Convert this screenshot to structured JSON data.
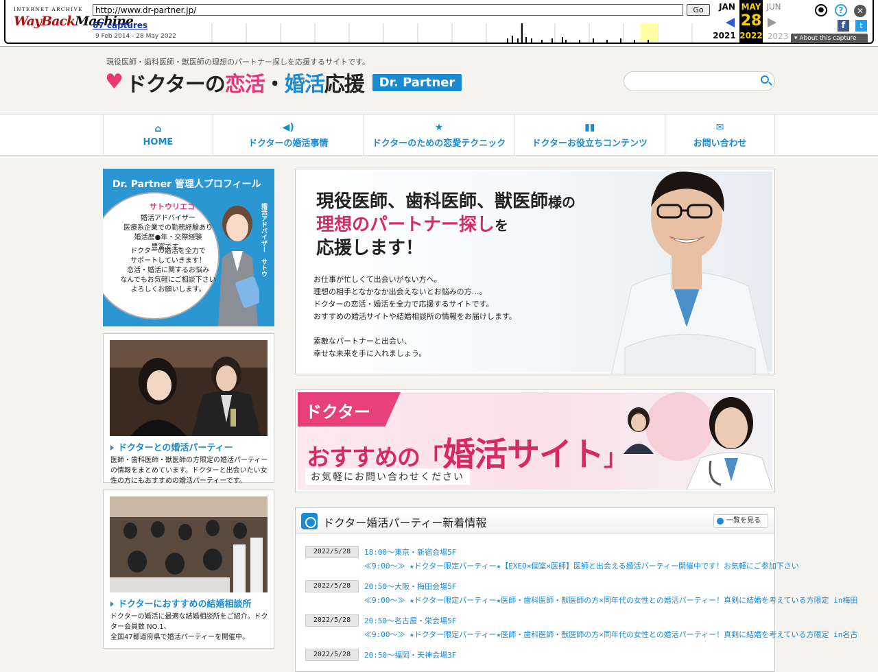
{
  "wayback": {
    "logo_top": "INTERNET ARCHIVE",
    "logo_main": "WayBack",
    "logo_main2": "Machine",
    "url": "http://www.dr-partner.jp/",
    "go_label": "Go",
    "captures": "67 captures",
    "range": "9 Feb 2014 - 28 May 2022",
    "month_prev": "JAN",
    "month_cur": "MAY",
    "month_next": "JUN",
    "day": "28",
    "year_prev": "2021",
    "year_cur": "2022",
    "year_next": "2023",
    "about": "About this capture",
    "fb": "f",
    "tw": "t",
    "help": "?",
    "close": "✕",
    "user": "●"
  },
  "header": {
    "tagline": "現役医師・歯科医師・獣医師の理想のパートナー探しを応援するサイトです。",
    "logo_pre": "ドクターの",
    "logo_koi": "恋活",
    "logo_dot": "・",
    "logo_kon": "婚活",
    "logo_post": "応援",
    "badge": "Dr. Partner",
    "search_placeholder": ""
  },
  "nav": {
    "items": [
      {
        "label": "HOME",
        "icon": "home-icon",
        "glyph": "⌂"
      },
      {
        "label": "ドクターの婚活事情",
        "icon": "megaphone-icon",
        "glyph": "◀)"
      },
      {
        "label": "ドクターのための恋愛テクニック",
        "icon": "star-icon",
        "glyph": "★"
      },
      {
        "label": "ドクターお役立ちコンテンツ",
        "icon": "book-icon",
        "glyph": "▮▮"
      },
      {
        "label": "お問い合わせ",
        "icon": "mail-icon",
        "glyph": "✉"
      }
    ]
  },
  "profile": {
    "title": "Dr. Partner  管理人プロフィール",
    "name": "サトウリエコ",
    "lines1": [
      "婚活アドバイザー",
      "医療系企業での勤務経験あり",
      "婚活歴●年・交際経験",
      "豊富です。"
    ],
    "lines2": [
      "ドクターの婚活を全力で",
      "サポートしていきます！",
      "恋活・婚活に関するお悩み",
      "なんでもお気軽にご相談下さい",
      "よろしくお願いします。"
    ],
    "vertical": "婚活アドバイザー　サトウ"
  },
  "cards": [
    {
      "title": "ドクターとの婚活パーティー",
      "text": "医師・歯科医師・獣医師の方限定の婚活パーティーの情報をまとめています。ドクターと出会いたい女性の方にもおすすめの婚活パーティーです。"
    },
    {
      "title": "ドクターにおすすめの結婚相談所",
      "text": "ドクターの婚活に最適な結婚相談所をご紹介。ドクター会員数 NO.1、",
      "text2": "全国47都道府県で婚活パーティーを開催中。"
    }
  ],
  "hero": {
    "line1a": "現役医師、歯科医師、獣医師",
    "line1b": "様の",
    "line2a": "理想のパートナー探し",
    "line2b": "を",
    "line3": "応援します！",
    "p1": [
      "お仕事が忙しくて出会いがない方へ。",
      "理想の相手となかなか出会えないとお悩みの方…。",
      "ドクターの恋活・婚活を全力で応援するサイトです。",
      "おすすめの婚活サイトや結婚相談所の情報をお届けします。"
    ],
    "p2": [
      "素敵なパートナーと出会い、",
      "幸せな未来を手に入れましょう。"
    ]
  },
  "banner": {
    "tag": "ドクター",
    "main_pre": "おすすめの「",
    "main_big": "婚活サイト",
    "main_post": "」",
    "sub": "お気軽にお問い合わせください"
  },
  "news": {
    "title": "ドクター婚活パーティー新着情報",
    "more": "一覧を見る",
    "rows": [
      {
        "date": "2022/5/28",
        "l1": "18:00～東京・新宿会場5F",
        "l2": "≪9:00～≫ ★ドクター限定パーティー★【EXEO×個室×医師】医師と出会える婚活パーティー開催中です！お気軽にご参加下さい"
      },
      {
        "date": "2022/5/28",
        "l1": "20:50～大阪・梅田会場5F",
        "l2": "≪9:00～≫ ★ドクター限定パーティー★医師・歯科医師・獣医師の方×同年代の女性との婚活パーティー！真剣に結婚を考えている方限定 in梅田"
      },
      {
        "date": "2022/5/28",
        "l1": "20:50～名古屋・栄会場5F",
        "l2": "≪9:00～≫ ★ドクター限定パーティー★医師・歯科医師・獣医師の方×同年代の女性との婚活パーティー！真剣に結婚を考えている方限定 in名古"
      },
      {
        "date": "2022/5/28",
        "l1": "20:50～福岡・天神会場3F",
        "l2": ""
      }
    ]
  },
  "colors": {
    "accent": "#1a8bd1",
    "pink": "#e8337a"
  }
}
